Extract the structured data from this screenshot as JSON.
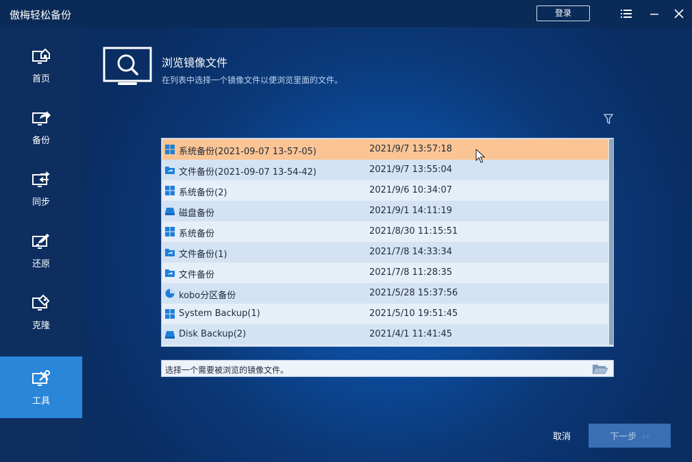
{
  "app": {
    "title": "傲梅轻松备份",
    "login_label": "登录"
  },
  "sidebar": {
    "items": [
      {
        "label": "首页",
        "icon": "home-icon"
      },
      {
        "label": "备份",
        "icon": "backup-icon"
      },
      {
        "label": "同步",
        "icon": "sync-icon"
      },
      {
        "label": "还原",
        "icon": "restore-icon"
      },
      {
        "label": "克隆",
        "icon": "clone-icon"
      },
      {
        "label": "工具",
        "icon": "tools-icon",
        "active": true
      }
    ]
  },
  "page": {
    "title": "浏览镜像文件",
    "subtitle": "在列表中选择一个镜像文件以便浏览里面的文件。"
  },
  "images": [
    {
      "name": "系统备份(2021-09-07 13-57-05)",
      "date": "2021/9/7 13:57:18",
      "type": "windows-icon",
      "selected": true
    },
    {
      "name": "文件备份(2021-09-07 13-54-42)",
      "date": "2021/9/7 13:55:04",
      "type": "folder-backup-icon"
    },
    {
      "name": "系统备份(2)",
      "date": "2021/9/6 10:34:07",
      "type": "windows-icon"
    },
    {
      "name": "磁盘备份",
      "date": "2021/9/1 14:11:19",
      "type": "disk-icon"
    },
    {
      "name": "系统备份",
      "date": "2021/8/30 11:15:51",
      "type": "windows-icon"
    },
    {
      "name": "文件备份(1)",
      "date": "2021/7/8 14:33:34",
      "type": "folder-backup-icon"
    },
    {
      "name": "文件备份",
      "date": "2021/7/8 11:28:35",
      "type": "folder-backup-icon"
    },
    {
      "name": "kobo分区备份",
      "date": "2021/5/28 15:37:56",
      "type": "partition-icon"
    },
    {
      "name": "System Backup(1)",
      "date": "2021/5/10 19:51:45",
      "type": "windows-icon"
    },
    {
      "name": "Disk Backup(2)",
      "date": "2021/4/1 11:41:45",
      "type": "disk-icon"
    }
  ],
  "path_bar": {
    "text": "选择一个需要被浏览的镜像文件。"
  },
  "footer": {
    "cancel_label": "取消",
    "next_label": "下一步",
    "next_arrows": "››"
  },
  "colors": {
    "accent": "#2a86d9",
    "selected_row": "#fbc494",
    "background": "#0b3877"
  }
}
